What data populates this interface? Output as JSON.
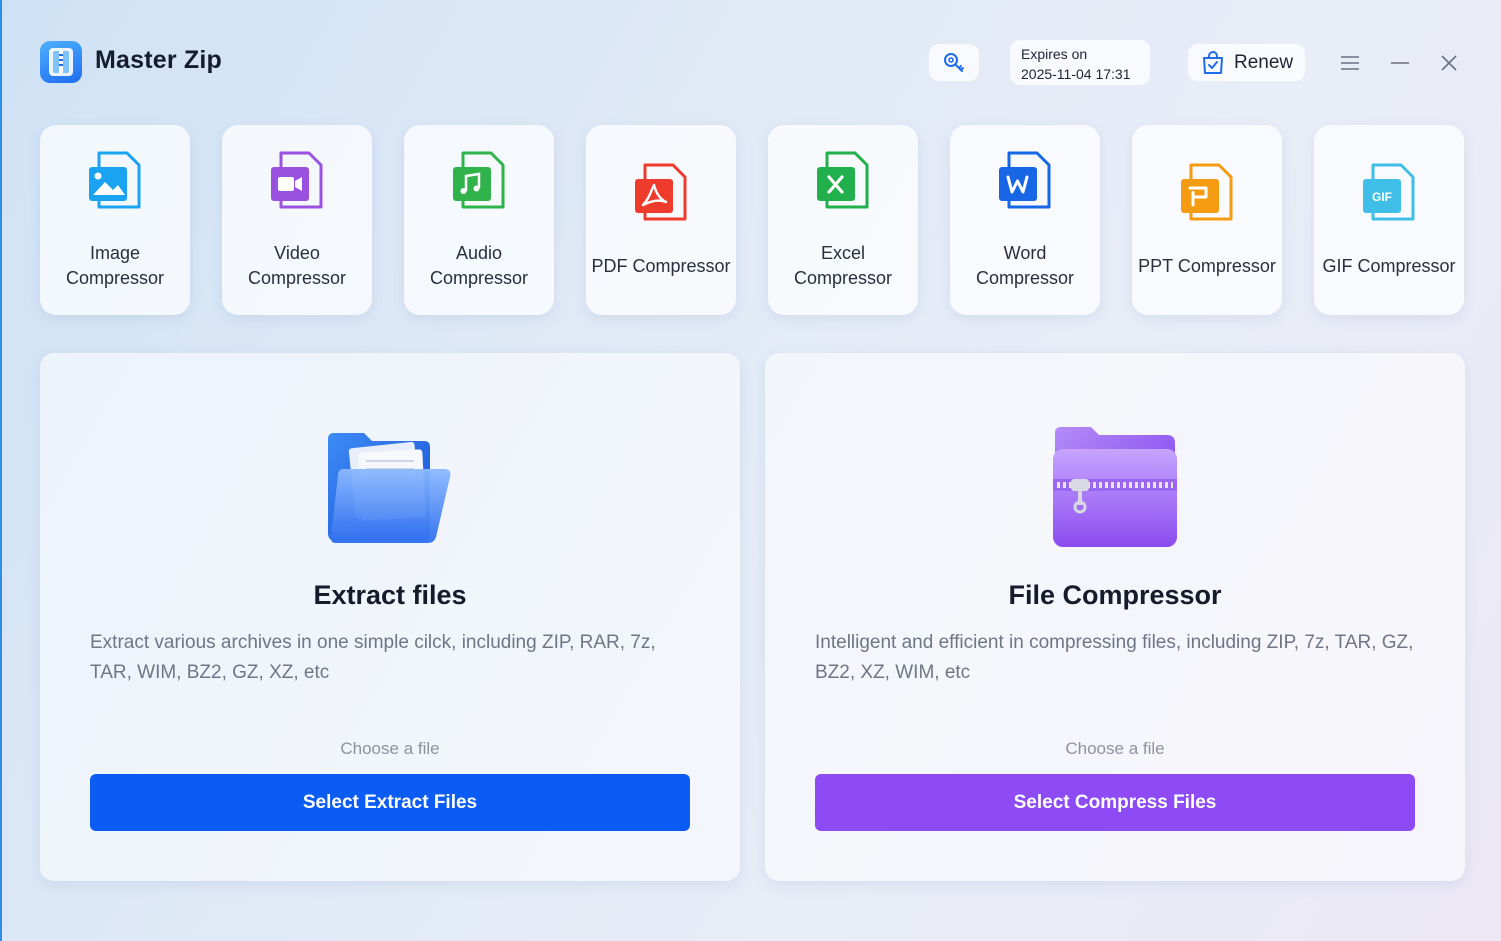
{
  "app": {
    "title": "Master Zip"
  },
  "header": {
    "expires_label": "Expires on",
    "expires_date": "2025-11-04 17:31",
    "renew_label": "Renew"
  },
  "tools": [
    {
      "label": "Image\nCompressor",
      "icon": "image-file-icon",
      "color": "#1aa3f0"
    },
    {
      "label": "Video\nCompressor",
      "icon": "video-file-icon",
      "color": "#9b51e0"
    },
    {
      "label": "Audio\nCompressor",
      "icon": "audio-file-icon",
      "color": "#2fb34a"
    },
    {
      "label": "PDF Compressor",
      "icon": "pdf-file-icon",
      "color": "#ef3b2c"
    },
    {
      "label": "Excel\nCompressor",
      "icon": "excel-file-icon",
      "color": "#21b04b"
    },
    {
      "label": "Word\nCompressor",
      "icon": "word-file-icon",
      "color": "#1666e6"
    },
    {
      "label": "PPT Compressor",
      "icon": "ppt-file-icon",
      "color": "#f59b12"
    },
    {
      "label": "GIF Compressor",
      "icon": "gif-file-icon",
      "color": "#3fbfe8"
    }
  ],
  "extract": {
    "title": "Extract files",
    "description": "Extract various archives in one simple cilck, including ZIP, RAR, 7z, TAR, WIM, BZ2, GZ, XZ, etc",
    "choose": "Choose a file",
    "button": "Select Extract Files",
    "color": "#0a5cf5"
  },
  "compress": {
    "title": "File Compressor",
    "description": "Intelligent and efficient in compressing files, including ZIP, 7z, TAR, GZ, BZ2, XZ, WIM, etc",
    "choose": "Choose a file",
    "button": "Select Compress Files",
    "color": "#8d4af5"
  }
}
